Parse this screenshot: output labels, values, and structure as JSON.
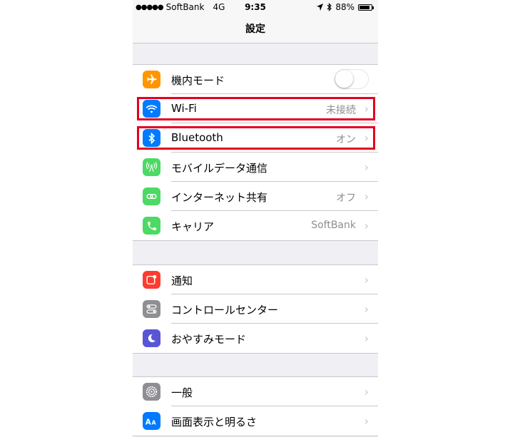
{
  "status": {
    "carrier": "SoftBank",
    "network": "4G",
    "time": "9:35",
    "battery": "88%",
    "battery_level": 0.88
  },
  "nav": {
    "title": "設定"
  },
  "groups": [
    {
      "rows": [
        {
          "label": "機内モード",
          "icon": "airplane-icon",
          "color": "#ff9500",
          "toggle": "off"
        },
        {
          "label": "Wi-Fi",
          "value": "未接続",
          "icon": "wifi-icon",
          "color": "#007aff"
        },
        {
          "label": "Bluetooth",
          "value": "オン",
          "icon": "bluetooth-icon",
          "color": "#007aff"
        },
        {
          "label": "モバイルデータ通信",
          "icon": "cellular-antenna-icon",
          "color": "#4cd964"
        },
        {
          "label": "インターネット共有",
          "value": "オフ",
          "icon": "hotspot-link-icon",
          "color": "#4cd964"
        },
        {
          "label": "キャリア",
          "value": "SoftBank",
          "icon": "phone-icon",
          "color": "#4cd964"
        }
      ]
    },
    {
      "rows": [
        {
          "label": "通知",
          "icon": "notifications-icon",
          "color": "#ff3b30"
        },
        {
          "label": "コントロールセンター",
          "icon": "control-center-icon",
          "color": "#8e8e93"
        },
        {
          "label": "おやすみモード",
          "icon": "moon-icon",
          "color": "#5856d6"
        }
      ]
    },
    {
      "rows": [
        {
          "label": "一般",
          "icon": "gear-icon",
          "color": "#8e8e93"
        },
        {
          "label": "画面表示と明るさ",
          "icon": "display-brightness-icon",
          "color": "#007aff"
        }
      ]
    }
  ],
  "annotations": {
    "highlight_color": "#e6001f",
    "highlighted_rows": [
      "Wi-Fi",
      "Bluetooth"
    ]
  }
}
